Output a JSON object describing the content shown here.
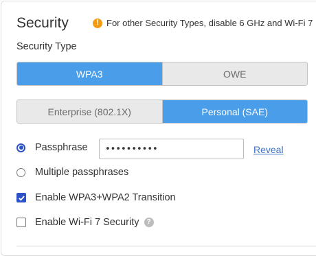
{
  "section": {
    "title": "Security",
    "notice": "For other Security Types, disable 6 GHz and Wi-Fi 7",
    "notice_icon": "!"
  },
  "security_type": {
    "label": "Security Type",
    "options": [
      {
        "label": "WPA3",
        "selected": true
      },
      {
        "label": "OWE",
        "selected": false
      }
    ]
  },
  "auth_mode": {
    "options": [
      {
        "label": "Enterprise (802.1X)",
        "selected": false
      },
      {
        "label": "Personal (SAE)",
        "selected": true
      }
    ]
  },
  "passphrase": {
    "radio_label": "Passphrase",
    "selected": true,
    "value": "••••••••••",
    "reveal_label": "Reveal"
  },
  "multiple": {
    "radio_label": "Multiple passphrases",
    "selected": false
  },
  "transition": {
    "label": "Enable WPA3+WPA2 Transition",
    "checked": true
  },
  "wifi7": {
    "label": "Enable Wi-Fi 7 Security",
    "checked": false,
    "help_icon": "?"
  },
  "colors": {
    "accent": "#4a9de9",
    "control": "#2b53c7",
    "link": "#3b73c9",
    "warning": "#f39c12"
  }
}
